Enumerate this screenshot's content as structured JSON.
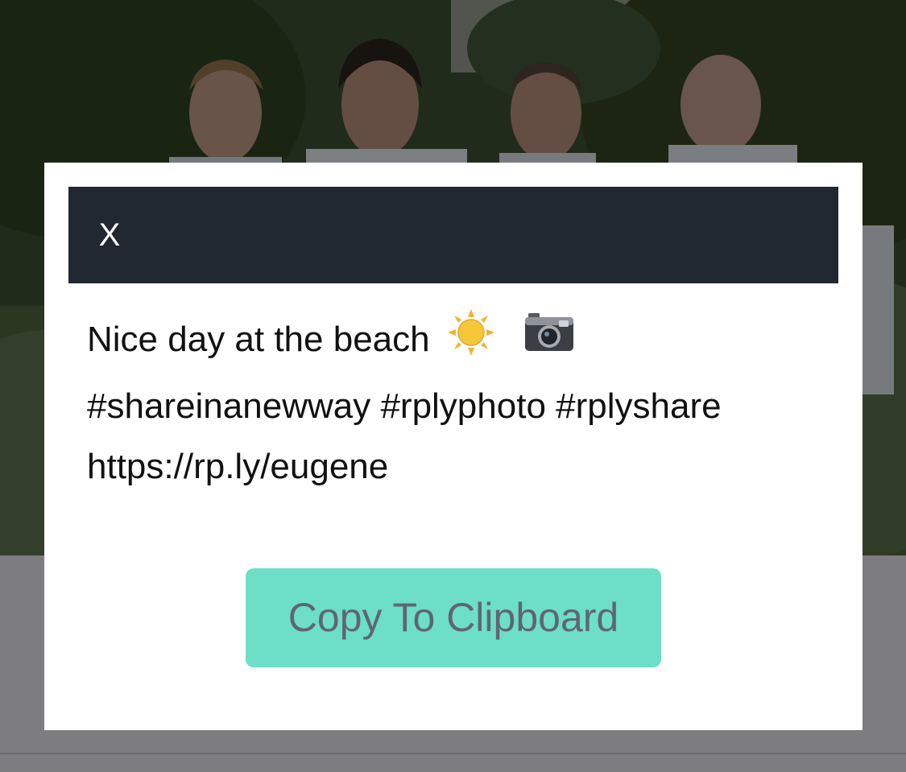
{
  "modal": {
    "close_label": "X",
    "caption": {
      "line1_text": "Nice day at the beach",
      "line1_icons": [
        "sun-icon",
        "camera-icon"
      ],
      "line2": "#shareinanewway #rplyphoto #rplyshare",
      "line3": "https://rp.ly/eugene"
    },
    "copy_button_label": "Copy To Clipboard"
  },
  "colors": {
    "header_bg": "#222831",
    "button_bg": "#6cdfc6",
    "button_text": "#5f6670",
    "overlay": "#7d7d7f"
  }
}
